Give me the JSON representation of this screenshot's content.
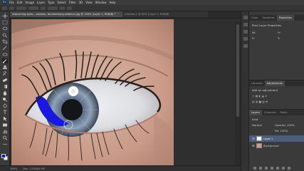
{
  "app": {
    "logo": "Ps"
  },
  "menu": [
    "File",
    "Edit",
    "Image",
    "Layer",
    "Type",
    "Select",
    "Filter",
    "3D",
    "View",
    "Window",
    "Help"
  ],
  "document_tabs": [
    {
      "title": "retouching-eyes-...ouldeer, be-breedung-vizbecal.jpg @ 100% (Layer 1, RGB/8) *",
      "active": true
    },
    {
      "title": "Untitled-1 @ 50% (Layer 1, RGB/8)",
      "active": false
    }
  ],
  "status": {
    "zoom": "100%",
    "doc": "Doc: 2.25M/4.5M"
  },
  "panels": {
    "top_tabs": [
      "Color",
      "Swatches",
      "Properties"
    ],
    "properties_title": "Pixel Layer Properties",
    "properties_fields": [
      "W:",
      "H:",
      "X:",
      "Y:"
    ],
    "mid_tabs": [
      "Libraries",
      "Adjustments"
    ],
    "adjustments_title": "Add an adjustment",
    "layers_tabs": [
      "Layers",
      "Channels",
      "Paths"
    ],
    "layers_kind": "Kind",
    "layers_mode": "Normal",
    "layers_opacity": "Opacity: 100%",
    "layers_fill": "Fill: 100%",
    "layers": [
      {
        "name": "Layer 1",
        "selected": true
      },
      {
        "name": "Background",
        "selected": false
      }
    ]
  },
  "colors": {
    "foreground": "#1010d0",
    "background": "#ffffff",
    "accent": "#4d5d7a"
  }
}
